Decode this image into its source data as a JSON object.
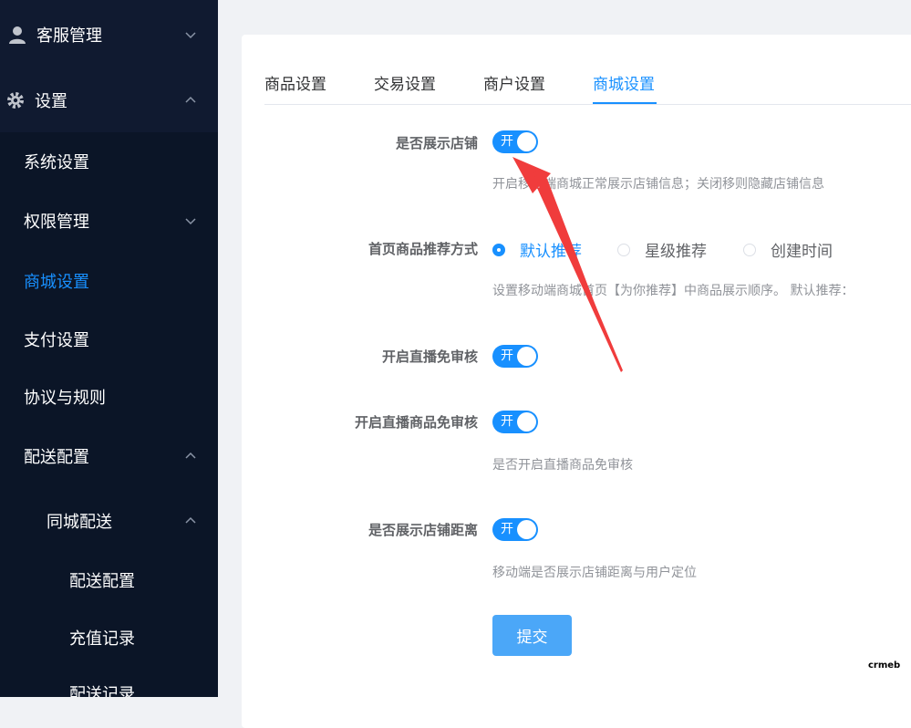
{
  "sidebar": {
    "items": [
      {
        "label": "客服管理"
      },
      {
        "label": "设置"
      },
      {
        "label": "系统设置"
      },
      {
        "label": "权限管理"
      },
      {
        "label": "商城设置"
      },
      {
        "label": "支付设置"
      },
      {
        "label": "协议与规则"
      },
      {
        "label": "配送配置"
      },
      {
        "label": "同城配送"
      },
      {
        "label": "配送配置"
      },
      {
        "label": "充值记录"
      },
      {
        "label": "配送记录"
      }
    ]
  },
  "tabs": [
    {
      "label": "商品设置"
    },
    {
      "label": "交易设置"
    },
    {
      "label": "商户设置"
    },
    {
      "label": "商城设置"
    }
  ],
  "form": {
    "show_store": {
      "label": "是否展示店铺",
      "switch_text": "开",
      "hint": "开启移动端商城正常展示店铺信息；关闭移则隐藏店铺信息"
    },
    "recommend": {
      "label": "首页商品推荐方式",
      "options": [
        "默认推荐",
        "星级推荐",
        "创建时间"
      ],
      "selected": "默认推荐",
      "hint": "设置移动端商城首页【为你推荐】中商品展示顺序。 默认推荐："
    },
    "live_no_review": {
      "label": "开启直播免审核",
      "switch_text": "开"
    },
    "live_goods_no_review": {
      "label": "开启直播商品免审核",
      "switch_text": "开",
      "hint": "是否开启直播商品免审核"
    },
    "show_distance": {
      "label": "是否展示店铺距离",
      "switch_text": "开",
      "hint": "移动端是否展示店铺距离与用户定位"
    },
    "submit_label": "提交"
  },
  "watermark": "crmeb",
  "colors": {
    "primary": "#1890ff",
    "sidebar_bg": "#0b1527",
    "annotation": "#f03c3c"
  }
}
